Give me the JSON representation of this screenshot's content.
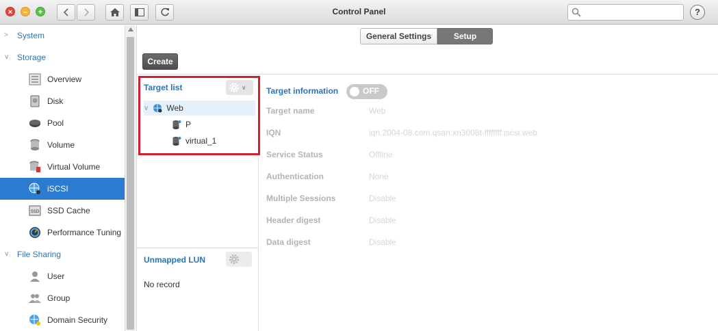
{
  "window": {
    "title": "Control Panel"
  },
  "search": {
    "placeholder": "",
    "value": ""
  },
  "help": {
    "label": "?"
  },
  "sidebar": {
    "sections": [
      {
        "label": "System",
        "expanded": false
      },
      {
        "label": "Storage",
        "expanded": true
      },
      {
        "label": "File Sharing",
        "expanded": true
      }
    ],
    "storage_items": [
      {
        "label": "Overview",
        "icon": "overview-icon"
      },
      {
        "label": "Disk",
        "icon": "disk-icon"
      },
      {
        "label": "Pool",
        "icon": "pool-icon"
      },
      {
        "label": "Volume",
        "icon": "volume-icon"
      },
      {
        "label": "Virtual Volume",
        "icon": "virtual-volume-icon"
      },
      {
        "label": "iSCSI",
        "icon": "iscsi-icon",
        "active": true
      },
      {
        "label": "SSD Cache",
        "icon": "ssd-cache-icon"
      },
      {
        "label": "Performance Tuning",
        "icon": "performance-icon"
      }
    ],
    "file_sharing_items": [
      {
        "label": "User",
        "icon": "user-icon"
      },
      {
        "label": "Group",
        "icon": "group-icon"
      },
      {
        "label": "Domain Security",
        "icon": "domain-security-icon"
      }
    ]
  },
  "tabs": [
    {
      "label": "General Settings",
      "active": false
    },
    {
      "label": "Setup",
      "active": true
    }
  ],
  "toolbar": {
    "create_label": "Create"
  },
  "target_list": {
    "title": "Target list",
    "tree": [
      {
        "label": "Web",
        "type": "target",
        "expanded": true
      },
      {
        "label": "P",
        "type": "lun"
      },
      {
        "label": "virtual_1",
        "type": "lun"
      }
    ]
  },
  "unmapped_lun": {
    "title": "Unmapped LUN",
    "empty_text": "No record"
  },
  "target_info": {
    "title": "Target information",
    "toggle_label": "OFF",
    "rows": [
      {
        "key": "Target name",
        "value": "Web"
      },
      {
        "key": "IQN",
        "value": "iqn.2004-08.com.qsan:xn3008t-ffffffff:iscsi.web"
      },
      {
        "key": "Service Status",
        "value": "Offline"
      },
      {
        "key": "Authentication",
        "value": "None"
      },
      {
        "key": "Multiple Sessions",
        "value": "Disable"
      },
      {
        "key": "Header digest",
        "value": "Disable"
      },
      {
        "key": "Data digest",
        "value": "Disable"
      }
    ]
  },
  "colors": {
    "accent": "#2a73b8",
    "active_bg": "#2b7bd1",
    "highlight_border": "#d02030"
  }
}
